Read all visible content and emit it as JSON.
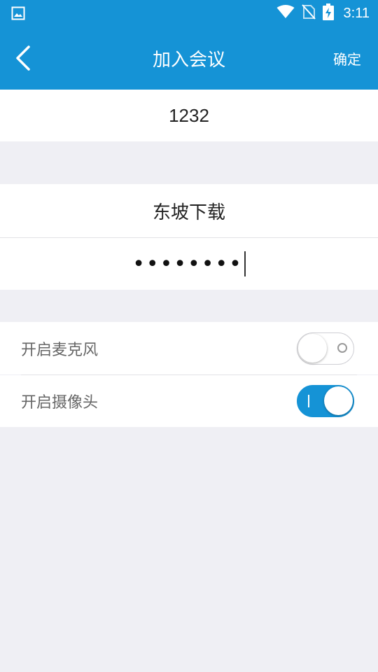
{
  "status_bar": {
    "time": "3:11",
    "icons": [
      "image-notification-icon",
      "wifi-icon",
      "no-sim-icon",
      "battery-charging-icon"
    ]
  },
  "header": {
    "title": "加入会议",
    "confirm_label": "确定",
    "back_icon": "chevron-left-icon"
  },
  "meeting": {
    "meeting_id": "1232",
    "name": "东坡下载",
    "password_masked": "••••••••"
  },
  "settings": {
    "microphone": {
      "label": "开启麦克风",
      "enabled": false
    },
    "camera": {
      "label": "开启摄像头",
      "enabled": true
    }
  },
  "colors": {
    "accent": "#1593d6",
    "background": "#efeff4",
    "surface": "#ffffff",
    "label_text": "#666666"
  }
}
